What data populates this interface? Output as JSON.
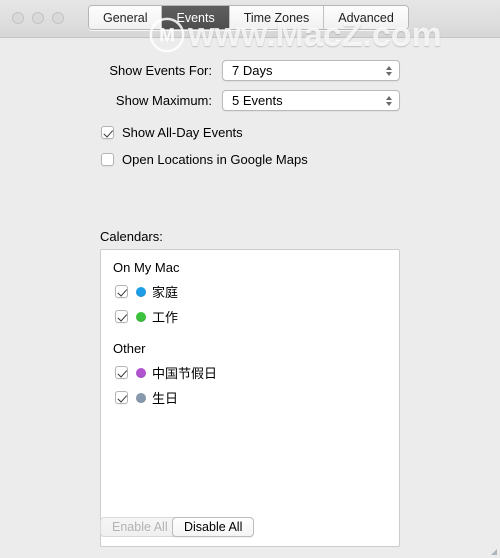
{
  "window": {
    "traffic_lights": [
      "close",
      "minimize",
      "zoom"
    ]
  },
  "tabs": [
    {
      "label": "General",
      "selected": false
    },
    {
      "label": "Events",
      "selected": true
    },
    {
      "label": "Time Zones",
      "selected": false
    },
    {
      "label": "Advanced",
      "selected": false
    }
  ],
  "watermark": {
    "text": "www.MacZ.com",
    "logo_letter": "M"
  },
  "settings": {
    "show_events_for": {
      "label": "Show Events For:",
      "value": "7 Days"
    },
    "show_maximum": {
      "label": "Show Maximum:",
      "value": "5 Events"
    },
    "show_all_day_events": {
      "label": "Show All-Day Events",
      "checked": true
    },
    "open_locations_google_maps": {
      "label": "Open Locations in Google Maps",
      "checked": false
    }
  },
  "calendars": {
    "label": "Calendars:",
    "groups": [
      {
        "name": "On My Mac",
        "items": [
          {
            "name": "家庭",
            "color": "#1e9ee8",
            "checked": true
          },
          {
            "name": "工作",
            "color": "#3cc23c",
            "checked": true
          }
        ]
      },
      {
        "name": "Other",
        "items": [
          {
            "name": "中国节假日",
            "color": "#b054d0",
            "checked": true
          },
          {
            "name": "生日",
            "color": "#8899ad",
            "checked": true
          }
        ]
      }
    ]
  },
  "buttons": {
    "enable_all": {
      "label": "Enable All",
      "disabled": true
    },
    "disable_all": {
      "label": "Disable All",
      "disabled": false
    }
  }
}
